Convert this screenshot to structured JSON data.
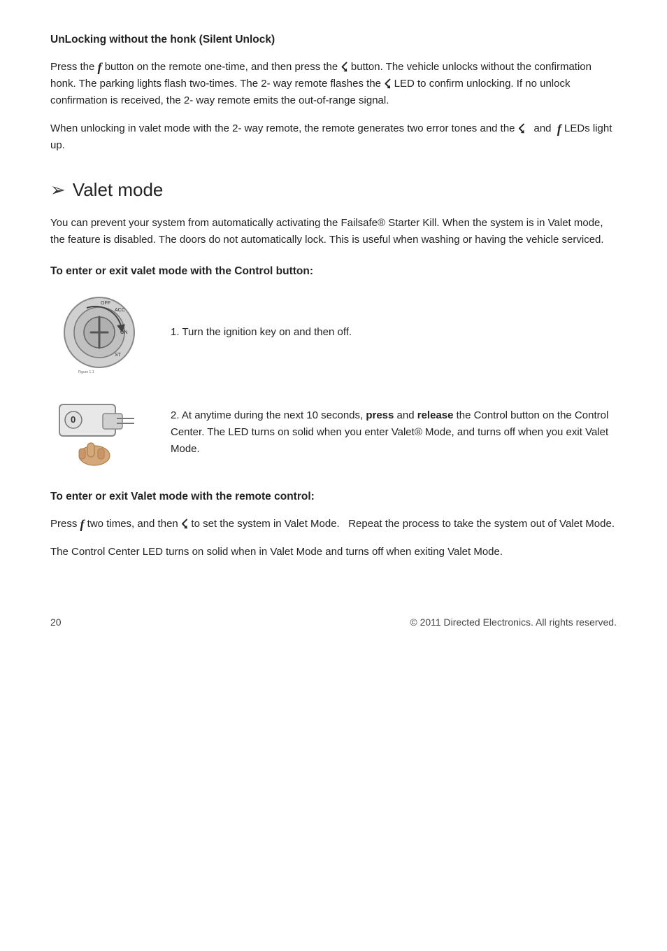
{
  "page": {
    "number": "20",
    "copyright": "© 2011 Directed Electronics. All rights reserved."
  },
  "section1": {
    "heading": "UnLocking without the honk (Silent Unlock)",
    "para1": "Press the  button on the remote one-time, and then press the  button. The vehicle unlocks without the confirmation honk. The parking lights flash two-times. The 2- way remote flashes the  LED to confirm unlocking. If no unlock confirmation is received, the 2- way remote emits the out-of-range signal.",
    "para2": "When unlocking in valet mode with the 2- way remote, the remote generates two error tones and the    and  LEDs light up."
  },
  "section2": {
    "heading": "Valet mode",
    "intro": "You can prevent your system from automatically activating the Failsafe® Starter Kill. When the system is in Valet mode, the feature is disabled. The doors do not automatically lock. This is useful when washing or having the vehicle serviced.",
    "subheading_control": "To enter or exit valet mode with the Control button:",
    "step1": "1. Turn the ignition key on and then off.",
    "step2_prefix": "2. At anytime during the next 10 seconds, ",
    "step2_bold1": "press",
    "step2_middle": " and ",
    "step2_bold2": "release",
    "step2_suffix": " the Control button on the Control Center. The LED turns on solid when you enter Valet® Mode, and turns off when you exit Valet Mode.",
    "subheading_remote": "To enter or exit Valet mode with the remote control:",
    "para_remote1": " two times, and then  to set the system in Valet Mode.   Repeat the process to take the system out of Valet Mode.",
    "para_remote1_prefix": "Press",
    "para_remote2": "The Control Center LED turns on solid when in Valet Mode and turns off when exiting Valet Mode."
  }
}
